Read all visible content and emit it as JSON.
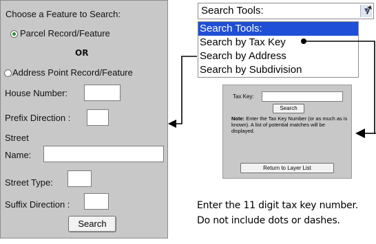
{
  "left_panel": {
    "heading": "Choose a Feature to Search:",
    "option_parcel": "Parcel Record/Feature",
    "or_text": "OR",
    "option_address": "Address Point Record/Feature",
    "house_number_label": "House Number:",
    "prefix_direction_label": "Prefix Direction :",
    "street_label": "Street",
    "name_label": "Name:",
    "street_type_label": "Street Type:",
    "suffix_direction_label": "Suffix Direction :",
    "search_button": "Search"
  },
  "dropdown": {
    "selected_value": "Search Tools:",
    "options": [
      "Search Tools:",
      "Search by Tax Key",
      "Search by Address",
      "Search by Subdivision"
    ],
    "highlighted_index": 0
  },
  "tax_key_panel": {
    "tax_key_label": "Tax Key:",
    "search_button": "Search",
    "note_label": "Note:",
    "note_text": "Enter the Tax Key Number (or as much as is known). A list of potential matches will be displayed.",
    "return_button": "Return to Layer List"
  },
  "caption": {
    "line1": "Enter the 11 digit tax key number.",
    "line2": "Do not include dots or dashes."
  },
  "colors": {
    "panel_bg": "#c8c8c8",
    "highlight": "#1f4fd6",
    "radio_selected": "#2e8b2e"
  }
}
